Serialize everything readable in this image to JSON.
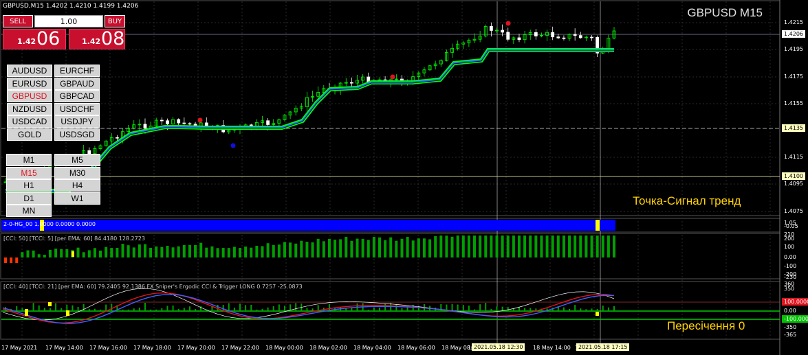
{
  "header": {
    "text": "GBPUSD,M15  1.4202 1.4210 1.4199 1.4206"
  },
  "symbol_title": "GBPUSD M15",
  "trade_panel": {
    "sell_label": "SELL",
    "buy_label": "BUY",
    "lot": "1.00",
    "sell_small": "1.42",
    "sell_big": "06",
    "buy_small": "1.42",
    "buy_big": "08"
  },
  "symbols": [
    "AUDUSD",
    "EURCHF",
    "EURUSD",
    "GBPAUD",
    "GBPUSD",
    "GBPCAD",
    "NZDUSD",
    "USDCHF",
    "USDCAD",
    "USDJPY",
    "GOLD",
    "USDSGD"
  ],
  "active_symbol": "GBPUSD",
  "timeframes": [
    "M1",
    "M5",
    "M15",
    "M30",
    "H1",
    "H4",
    "D1",
    "W1",
    "MN"
  ],
  "active_timeframe": "M15",
  "annotations": {
    "signal_trend": "Точка-Сигнал тренд",
    "cross_zero": "Пересічення 0"
  },
  "price_axis": [
    "1.4215",
    "1.4206",
    "1.4195",
    "1.4175",
    "1.4155",
    "1.4135",
    "1.4115",
    "1.4100",
    "1.4095",
    "1.4075"
  ],
  "price_highlights": {
    "current": "1.4206",
    "hline1": "1.4135",
    "hline2": "1.4100"
  },
  "ind1": {
    "label": "2-0-HG_00 1.0000 0.0000 0.0000",
    "axis": [
      "1.05",
      "-0.05"
    ]
  },
  "ind2": {
    "label": "[CCI: 50] [TCCI: 5] [per EMA: 60]  84.4180 128.2723",
    "axis": [
      "210",
      "200",
      "100",
      "0.00",
      "-100",
      "-200",
      "-230"
    ]
  },
  "ind3": {
    "label": "[CCI: 40] [TCCI: 21] [per EMA: 60]  79.2405 92.1386  FX Sniper's Ergodic CCI & Trigger LONG 0.7257 -25.0873",
    "axis": [
      "360",
      "350",
      "100",
      "0.00",
      "-100",
      "-350",
      "-365"
    ],
    "badges": {
      "plus100": "100.0000",
      "minus100": "-100.0000"
    }
  },
  "time_axis": [
    "17 May 2021",
    "17 May 14:00",
    "17 May 16:00",
    "17 May 18:00",
    "17 May 20:00",
    "17 May 22:00",
    "18 May 00:00",
    "18 May 02:00",
    "18 May 04:00",
    "18 May 06:00",
    "18 May 08:00",
    "18 May 1",
    "18 May 14:00",
    "18 May 16:00"
  ],
  "time_highlights": [
    "2021.05.18 12:30",
    "2021.05.18 17:15"
  ],
  "colors": {
    "bull": "#00ff00",
    "bear": "#ffffff",
    "ma_outer": "#00ff00",
    "ma_inner": "#1e6cff",
    "signal_red": "#e0141e",
    "signal_blue": "#1010e0",
    "hist_blue": "#0000ff",
    "yellow": "#ffff00",
    "ergodic": "#4060ff",
    "trigger": "#e0141e",
    "cci": "#ffffff"
  }
}
